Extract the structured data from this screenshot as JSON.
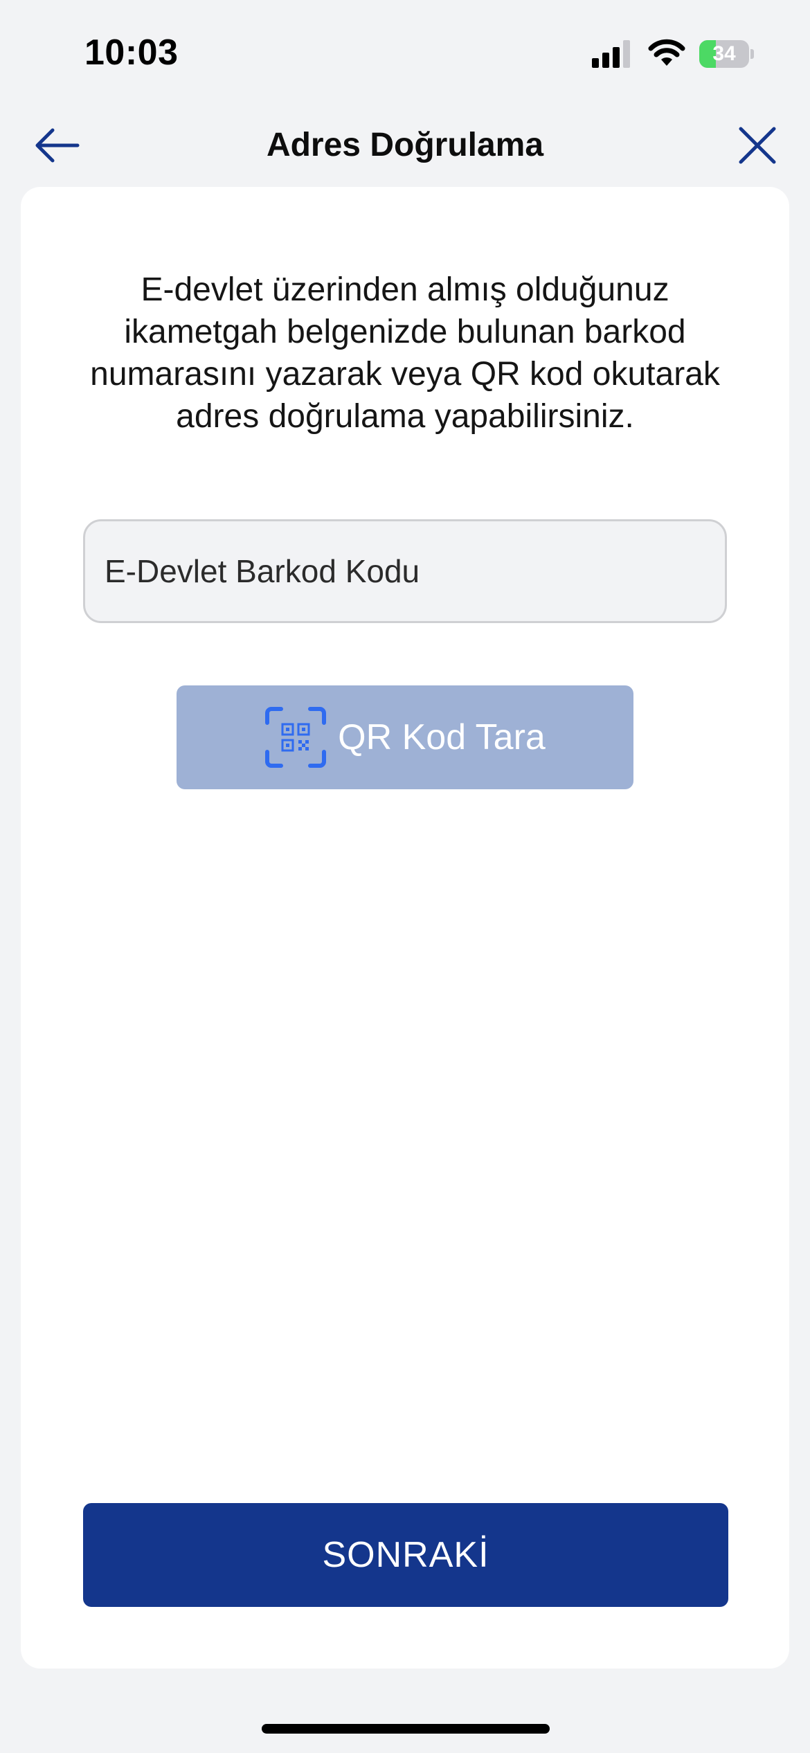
{
  "status_bar": {
    "time": "10:03",
    "battery_level": "34",
    "battery_fraction": 0.34,
    "signal_icon": "cellular-signal-icon",
    "wifi_icon": "wifi-icon",
    "battery_color": "#4cd964"
  },
  "nav": {
    "title": "Adres Doğrulama",
    "back_icon": "arrow-left-icon",
    "close_icon": "close-icon",
    "icon_color": "#14368c"
  },
  "content": {
    "description": "E-devlet üzerinden almış olduğunuz ikametgah belgenizde bulunan barkod numarasını yazarak veya QR kod okutarak adres doğrulama yapabilirsiniz.",
    "barcode_input": {
      "placeholder": "E-Devlet Barkod Kodu",
      "value": ""
    },
    "qr_button": {
      "label": "QR Kod Tara",
      "icon": "qr-scan-icon",
      "icon_color": "#2f6bf0",
      "background": "#9eb1d5"
    }
  },
  "footer": {
    "next_label": "SONRAKİ",
    "button_color": "#14368c"
  }
}
